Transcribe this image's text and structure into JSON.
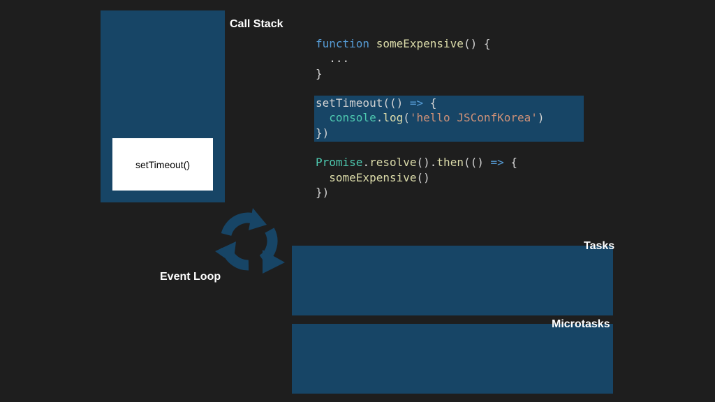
{
  "labels": {
    "call_stack": "Call Stack",
    "event_loop": "Event Loop",
    "tasks": "Tasks",
    "microtasks": "Microtasks"
  },
  "call_stack": {
    "frames": [
      "setTimeout()"
    ]
  },
  "code": {
    "line1": {
      "kw": "function",
      "name": "someExpensive",
      "rest": "() {"
    },
    "line2": "  ...",
    "line3": "}",
    "line5": {
      "name": "setTimeout",
      "mid": "(() ",
      "arrow": "=>",
      "rest": " {"
    },
    "line6": {
      "indent": "  ",
      "obj": "console",
      "dot": ".",
      "method": "log",
      "open": "(",
      "str": "'hello JSConfKorea'",
      "close": ")"
    },
    "line7": "})",
    "line9": {
      "cls": "Promise",
      "dot1": ".",
      "m1": "resolve",
      "mid1": "().",
      "m2": "then",
      "mid2": "(() ",
      "arrow": "=>",
      "rest": " {"
    },
    "line10": {
      "indent": "  ",
      "name": "someExpensive",
      "rest": "()"
    },
    "line11": "})"
  },
  "colors": {
    "background": "#1e1e1e",
    "panel": "#174566",
    "text": "#ffffff"
  },
  "icons": {
    "event_loop": "refresh-cycle-icon"
  }
}
